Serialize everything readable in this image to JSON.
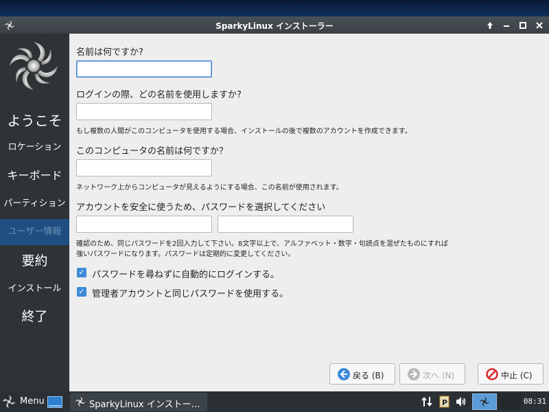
{
  "window": {
    "title": "SparkyLinux インストーラー"
  },
  "sidebar": {
    "items": [
      {
        "label": "ようこそ",
        "active": false
      },
      {
        "label": "ロケーション",
        "active": false
      },
      {
        "label": "キーボード",
        "active": false
      },
      {
        "label": "パーティション",
        "active": false
      },
      {
        "label": "ユーザー情報",
        "active": true
      },
      {
        "label": "要約",
        "active": false
      },
      {
        "label": "インストール",
        "active": false
      },
      {
        "label": "終了",
        "active": false
      }
    ]
  },
  "form": {
    "name_label": "名前は何ですか?",
    "name_value": "",
    "login_label": "ログインの際、どの名前を使用しますか?",
    "login_value": "",
    "login_hint": "もし複数の人間がこのコンピュータを使用する場合、インストールの後で複数のアカウントを作成できます。",
    "hostname_label": "このコンピュータの名前は何ですか？",
    "hostname_value": "",
    "hostname_hint": "ネットワーク上からコンピュータが見えるようにする場合、この名前が使用されます。",
    "password_label": "アカウントを安全に使うため、パスワードを選択してください",
    "password_value": "",
    "password_confirm_value": "",
    "password_hint_line1": "確認のため、同じパスワードを2回入力して下さい。8文字以上で、アルファベット・数字・句読点を混ぜたものにすれば",
    "password_hint_line2": "強いパスワードになります。パスワードは定期的に変更してください。",
    "autologin_label": "パスワードを尋ねずに自動的にログインする。",
    "autologin_checked": true,
    "admin_same_label": "管理者アカウントと同じパスワードを使用する。",
    "admin_same_checked": true
  },
  "buttons": {
    "back_label": "戻る (B)",
    "next_label": "次へ (N)",
    "cancel_label": "中止 (C)"
  },
  "taskbar": {
    "menu_label": "Menu",
    "task_label": "SparkyLinux インストー…",
    "clock": "08:31"
  },
  "colors": {
    "accent": "#3c8ad8",
    "sidebar_bg": "#2e3336",
    "sidebar_active": "#1f4f80",
    "cancel_red": "#d8262c"
  }
}
